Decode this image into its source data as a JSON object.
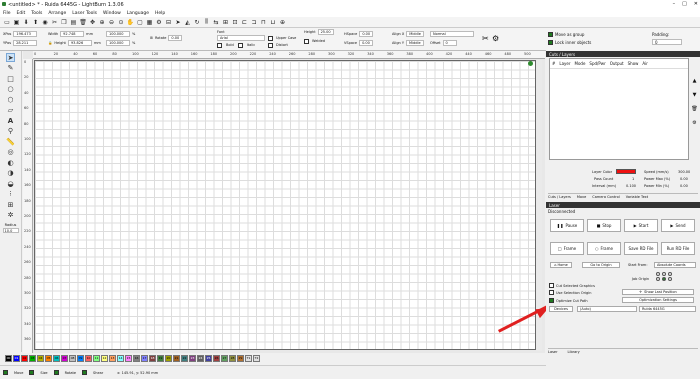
{
  "window": {
    "title": "<untitled> * - Ruida 6445G - LightBurn 1.3.06",
    "controls": [
      "–",
      "□",
      "✕"
    ]
  },
  "menu": [
    "File",
    "Edit",
    "Tools",
    "Arrange",
    "Laser Tools",
    "Window",
    "Language",
    "Help"
  ],
  "toolbar_icons": [
    "open-icon",
    "save-icon",
    "import-icon",
    "export-icon",
    "camera-icon",
    "cut-icon",
    "copy-icon",
    "paste-icon",
    "delete-icon",
    "move-icon",
    "zoom-in-icon",
    "zoom-out-icon",
    "zoom-fit-icon",
    "pan-icon",
    "monitor-icon",
    "trace-icon",
    "settings-icon",
    "align-icon",
    "send-icon",
    "mirror-icon",
    "rotate-icon",
    "distribute-icon",
    "flip-icon",
    "group-icon",
    "node-icon"
  ],
  "shape_props": {
    "x_label": "XPos",
    "x_value": "196.473",
    "y_label": "YPos",
    "y_value": "28.211",
    "width_label": "Width",
    "width_value": "92.748",
    "height_label": "Height",
    "height_value": "93.826",
    "unit": "mm",
    "scale_x": "100.000",
    "scale_y": "100.000",
    "pct": "%",
    "rotate_label": "Rotate",
    "rotate_value": "0.00",
    "font_label": "Font",
    "font_value": "Arial",
    "height2_label": "Height",
    "height2_value": "25.00",
    "hspace_label": "HSpace",
    "hspace_value": "0.00",
    "vspace_label": "VSpace",
    "vspace_value": "0.00",
    "bold": "Bold",
    "italic": "Italic",
    "upper": "Upper Case",
    "distort": "Distort",
    "welded": "Welded",
    "align_x_label": "Align X",
    "align_x_value": "Middle",
    "align_y_label": "Align Y",
    "align_y_value": "Middle",
    "normal_value": "Normal",
    "offset_label": "Offset",
    "offset_value": "0"
  },
  "top_right": {
    "move_label": "Move as group",
    "lock_label": "Lock inner objects",
    "padding_label": "Padding:",
    "padding_value": "0"
  },
  "tools_left": [
    "select-icon",
    "edit-nodes-icon",
    "rectangle-icon",
    "ellipse-icon",
    "polygon-icon",
    "line-icon",
    "text-icon",
    "position-laser-icon",
    "measure-icon",
    "offset-icon",
    "boolean-icon",
    "weld-icon",
    "subtract-icon",
    "array-icon",
    "grid-array-icon",
    "radial-array-icon"
  ],
  "radius": {
    "label": "Radius",
    "value": "10.0"
  },
  "rulers": {
    "h": [
      "0",
      "20",
      "40",
      "60",
      "80",
      "100",
      "120",
      "140",
      "160",
      "180",
      "200",
      "220",
      "240",
      "260",
      "280",
      "300",
      "320",
      "340",
      "360",
      "380",
      "400",
      "420",
      "440",
      "460",
      "480",
      "500"
    ],
    "v": [
      "0",
      "20",
      "40",
      "60",
      "80",
      "100",
      "120",
      "140",
      "160",
      "180",
      "200",
      "220",
      "240",
      "260",
      "280",
      "300",
      "320",
      "340",
      "360",
      "380"
    ]
  },
  "palette": [
    "00",
    "01",
    "02",
    "03",
    "04",
    "05",
    "06",
    "07",
    "08",
    "09",
    "10",
    "11",
    "12",
    "13",
    "14",
    "15",
    "16",
    "17",
    "18",
    "19",
    "20",
    "21",
    "22",
    "23",
    "24",
    "25",
    "26",
    "27",
    "28",
    "29",
    "T1",
    "T2"
  ],
  "palette_colors": [
    "#000000",
    "#0000ff",
    "#ff0000",
    "#00b000",
    "#b0b000",
    "#ff8000",
    "#00c0c0",
    "#d000d0",
    "#c0c0c0",
    "#0080ff",
    "#ff6060",
    "#80ff80",
    "#ffff80",
    "#ffa060",
    "#80ffff",
    "#ff80ff",
    "#808080",
    "#8080ff",
    "#804040",
    "#408040",
    "#a0a000",
    "#a06020",
    "#408080",
    "#804080",
    "#606060",
    "#4040a0",
    "#a04040",
    "#60a060",
    "#909040",
    "#b07030",
    "#e0e0e0",
    "#e0e0e0"
  ],
  "status": {
    "move": "Move",
    "size": "Size",
    "rotate": "Rotate",
    "shear": "Shear",
    "coords": "x: 145.91, y: 52.90 mm"
  },
  "cuts": {
    "columns": [
      "#",
      "Layer",
      "Mode",
      "Spd/Pwr",
      "Output",
      "Show",
      "Air"
    ],
    "panel_title": "Cuts / Layers",
    "layer_color_label": "Layer Color",
    "layer_color": "#ee1111",
    "speed_label": "Speed (mm/s)",
    "speed_value": "300.00",
    "pass_label": "Pass Count",
    "pass_value": "1",
    "power_max_label": "Power Max (%)",
    "power_max_value": "0.00",
    "interval_label": "Interval (mm)",
    "interval_value": "0.100",
    "power_min_label": "Power Min (%)",
    "power_min_value": "0.00",
    "tabs": [
      "Cuts / Layers",
      "Move",
      "Camera Control",
      "Variable Text"
    ]
  },
  "laser": {
    "title": "Laser",
    "status": "Disconnected",
    "pause": "Pause",
    "stop": "Stop",
    "start": "Start",
    "send": "Send",
    "frame1": "Frame",
    "frame2": "Frame",
    "save_rd": "Save RD File",
    "run_rd": "Run RD File",
    "home": "Home",
    "go_origin": "Go to Origin",
    "start_from_label": "Start From:",
    "start_from_value": "Absolute Coords",
    "job_origin_label": "Job Origin",
    "cut_selected": "Cut Selected Graphics",
    "use_selection_origin": "Use Selection Origin",
    "optimize": "Optimize Cut Path",
    "show_last": "Show Last Position",
    "opt_settings": "Optimization Settings",
    "devices_label": "Devices",
    "port_value": "(Auto)",
    "device_value": "Ruida 6445G",
    "bottom_tabs": [
      "Laser",
      "Library"
    ]
  }
}
